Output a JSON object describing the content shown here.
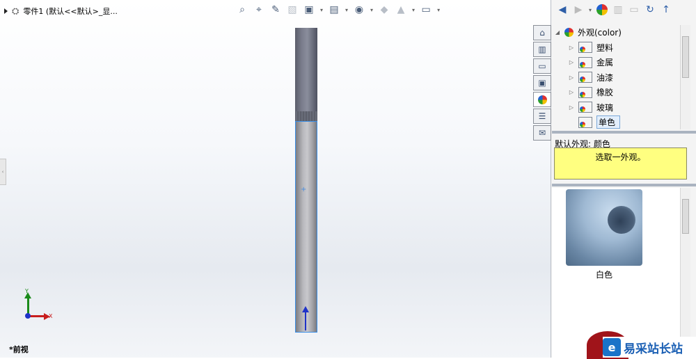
{
  "feature_tree": {
    "item": "零件1  (默认<<默认>_显..."
  },
  "heads_up_toolbar": {
    "icons": [
      "zoom-to-fit-icon",
      "zoom-area-icon",
      "previous-view-icon",
      "section-view-icon",
      "view-orientation-icon",
      "display-style-icon",
      "hide-show-icon",
      "edit-appearance-icon",
      "apply-scene-icon",
      "view-settings-icon"
    ]
  },
  "viewport": {
    "view_name": "*前视",
    "accent": "#3a8ee6"
  },
  "triad": {
    "y": "Y",
    "x": "X"
  },
  "task_pane": {
    "toolbar_icons": [
      "back-icon",
      "forward-icon",
      "appearance-icon",
      "library-icon",
      "folder-icon",
      "refresh-icon",
      "up-icon"
    ],
    "tabs": [
      "home-tab-icon",
      "design-library-tab-icon",
      "file-explorer-tab-icon",
      "view-palette-tab-icon",
      "appearances-tab-icon",
      "custom-properties-tab-icon",
      "forum-tab-icon"
    ],
    "tree": {
      "root": "外观(color)",
      "items": [
        "塑料",
        "金属",
        "油漆",
        "橡胶",
        "玻璃",
        "单色"
      ],
      "selected": "单色"
    },
    "default_appearance_label": "默认外观: 颜色",
    "hint_text": "选取一外观。",
    "thumbnail_label": "白色"
  },
  "watermark": {
    "text": "易采站长站"
  }
}
